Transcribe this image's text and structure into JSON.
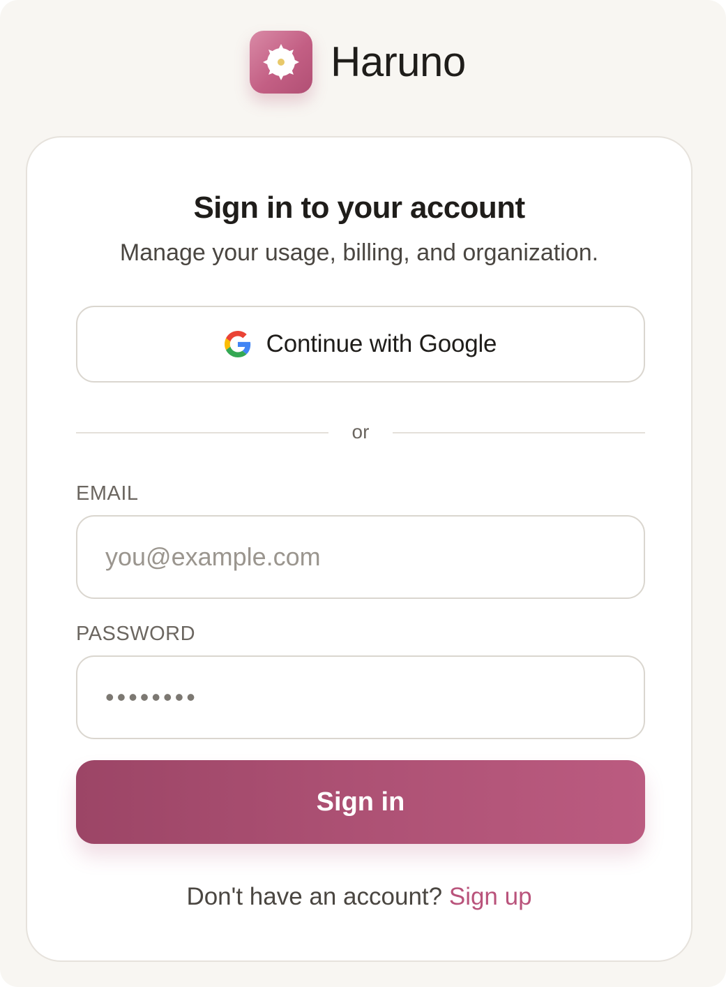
{
  "brand": {
    "name": "Haruno",
    "logo_icon": "flower-icon",
    "accent_color": "#b9537b"
  },
  "card": {
    "title": "Sign in to your account",
    "subtitle": "Manage your usage, billing, and organization."
  },
  "google_button": {
    "label": "Continue with Google",
    "icon": "google-icon"
  },
  "divider": {
    "text": "or"
  },
  "email": {
    "label": "EMAIL",
    "placeholder": "you@example.com",
    "value": ""
  },
  "password": {
    "label": "PASSWORD",
    "value": "••••••••"
  },
  "signin_button": {
    "label": "Sign in"
  },
  "signup": {
    "prompt": "Don't have an account?",
    "link_label": "Sign up"
  }
}
